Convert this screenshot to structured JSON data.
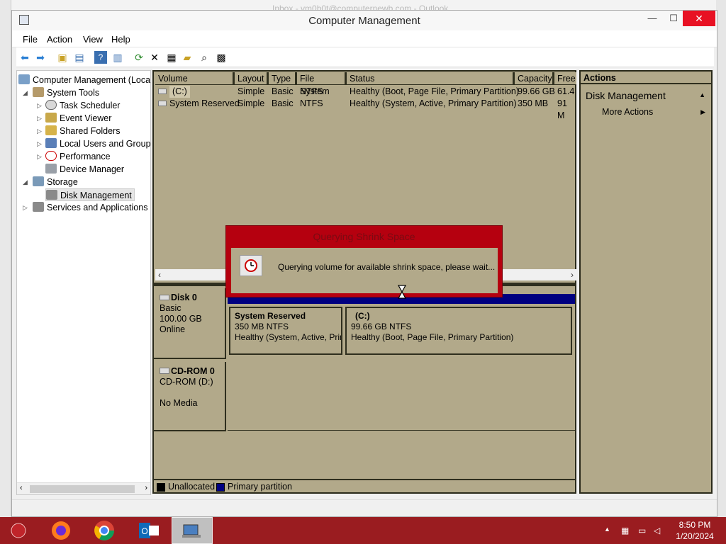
{
  "background": {
    "outlook_title": "Inbox - vm0b0t@computernewb.com - Outlook"
  },
  "window": {
    "title": "Computer Management",
    "close": "✕",
    "maximize": "☐",
    "minimize": "—"
  },
  "menu": [
    "File",
    "Action",
    "View",
    "Help"
  ],
  "tree": {
    "root": "Computer Management (Local",
    "system_tools": "System Tools",
    "task_scheduler": "Task Scheduler",
    "event_viewer": "Event Viewer",
    "shared_folders": "Shared Folders",
    "local_users": "Local Users and Groups",
    "performance": "Performance",
    "device_manager": "Device Manager",
    "storage": "Storage",
    "disk_management": "Disk Management",
    "services": "Services and Applications"
  },
  "volumes": {
    "columns": [
      "Volume",
      "Layout",
      "Type",
      "File System",
      "Status",
      "Capacity",
      "Free"
    ],
    "rows": [
      {
        "volume": "(C:)",
        "layout": "Simple",
        "type": "Basic",
        "fs": "NTFS",
        "status": "Healthy (Boot, Page File, Primary Partition)",
        "capacity": "99.66 GB",
        "free": "61.4"
      },
      {
        "volume": "System Reserved",
        "layout": "Simple",
        "type": "Basic",
        "fs": "NTFS",
        "status": "Healthy (System, Active, Primary Partition)",
        "capacity": "350 MB",
        "free": "91 M"
      }
    ]
  },
  "disk0": {
    "name": "Disk 0",
    "type": "Basic",
    "size": "100.00 GB",
    "state": "Online"
  },
  "partitions": {
    "sr": {
      "title": "System Reserved",
      "size": "350 MB NTFS",
      "status": "Healthy (System, Active, Prir"
    },
    "c": {
      "title": "(C:)",
      "size": "99.66 GB NTFS",
      "status": "Healthy (Boot, Page File, Primary Partition)"
    }
  },
  "cdrom": {
    "name": "CD-ROM 0",
    "drive": "CD-ROM (D:)",
    "media": "No Media"
  },
  "legend": {
    "unallocated": "Unallocated",
    "primary": "Primary partition"
  },
  "actions": {
    "header": "Actions",
    "section": "Disk Management",
    "more": "More Actions"
  },
  "dialog": {
    "title": "Querying Shrink Space",
    "message": "Querying volume for available shrink space, please wait..."
  },
  "taskbar": {
    "time": "8:50 PM",
    "date": "1/20/2024"
  },
  "colors": {
    "pane": "#b2a98a",
    "primary_partition": "#000080",
    "dialog": "#b5000f",
    "taskbar": "#9a1c20"
  }
}
